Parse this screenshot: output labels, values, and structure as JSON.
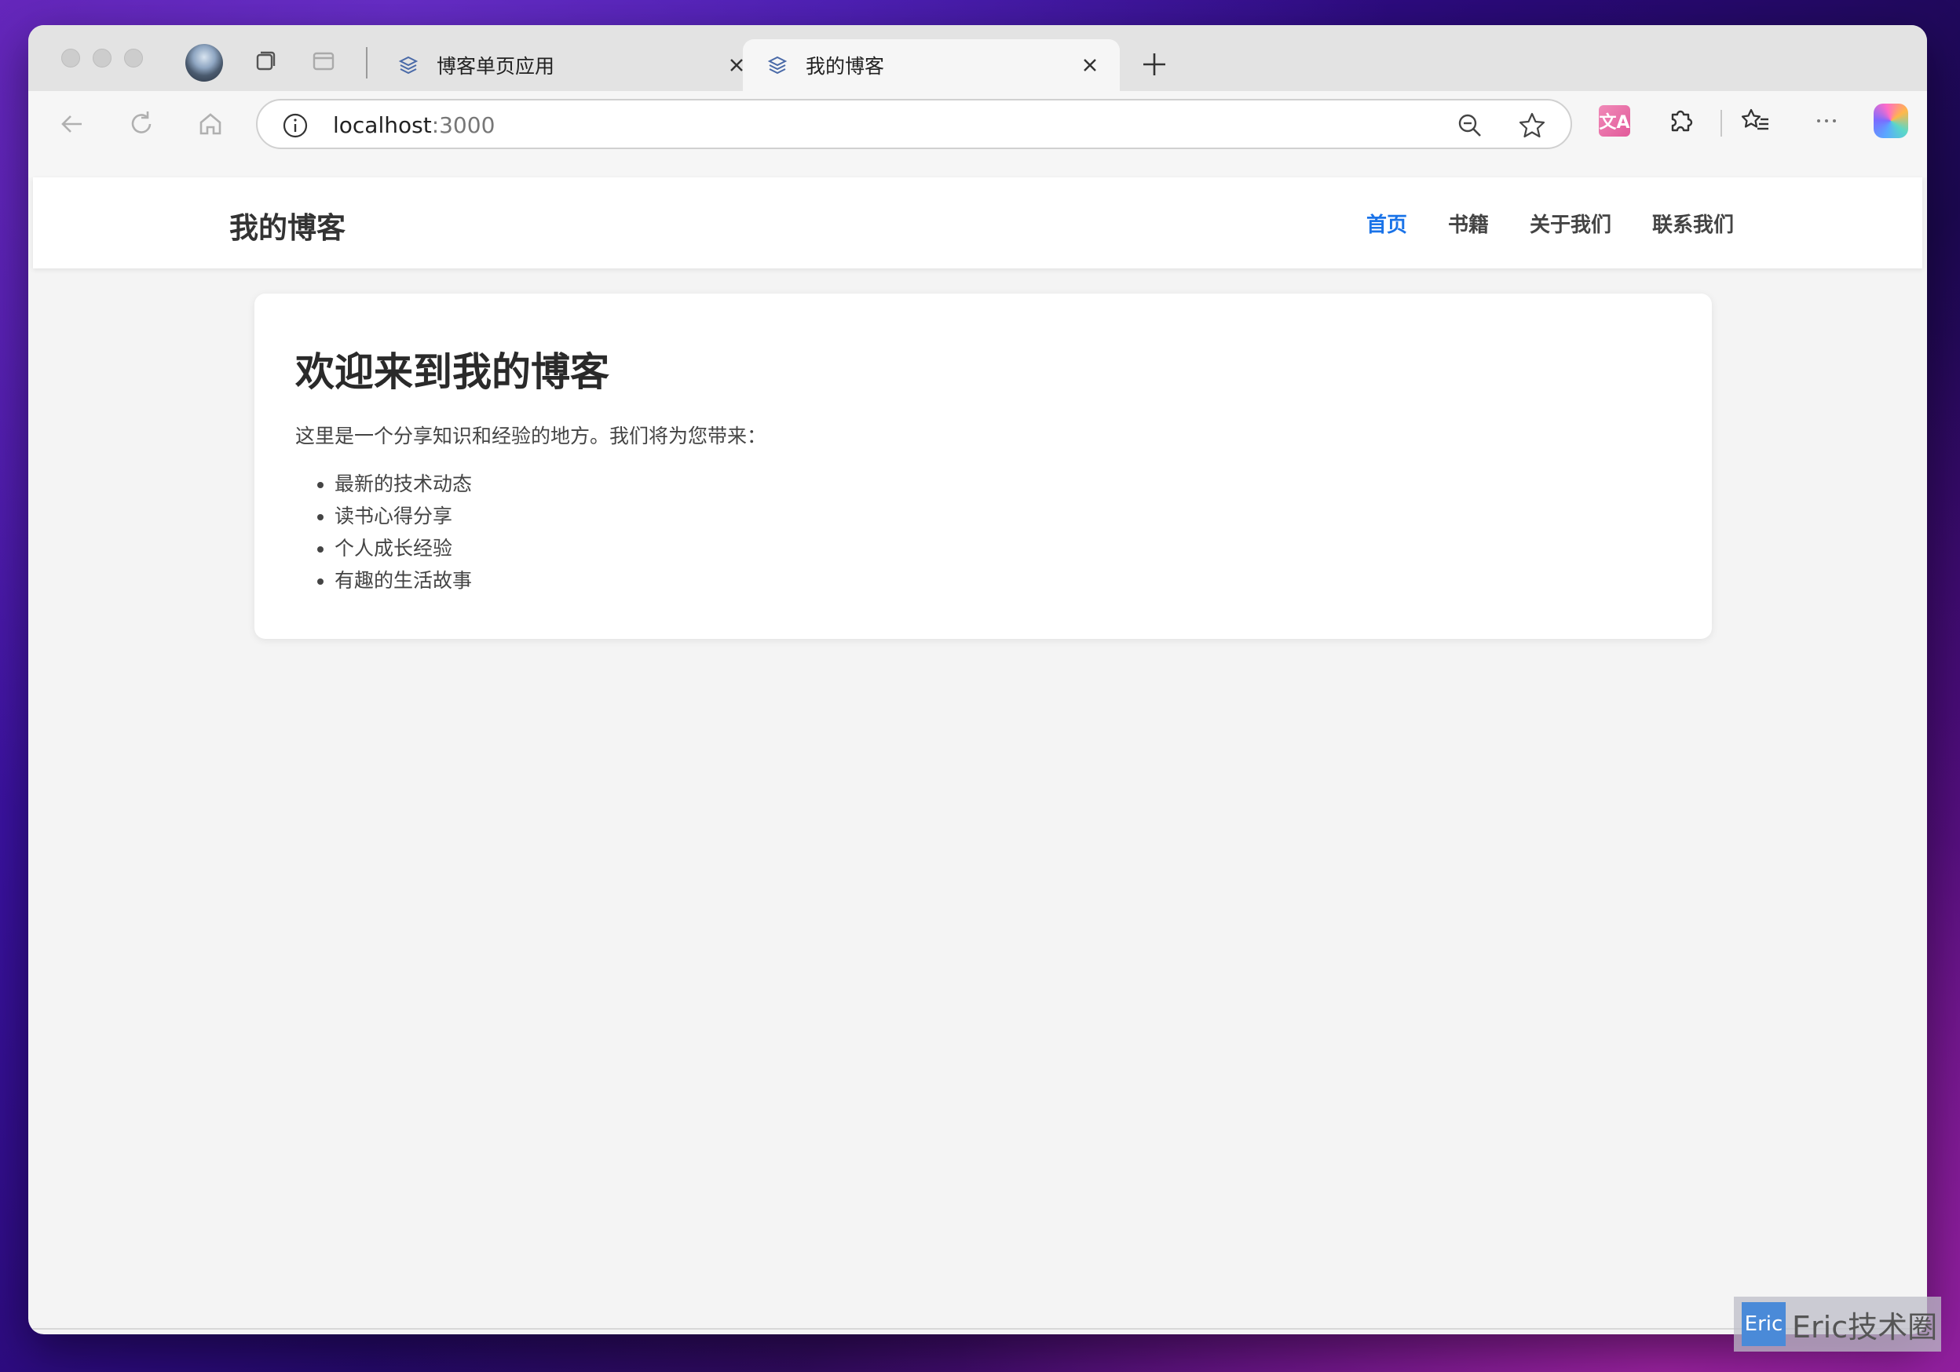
{
  "browser": {
    "tabs": [
      {
        "title": "博客单页应用",
        "active": false
      },
      {
        "title": "我的博客",
        "active": true
      }
    ],
    "address": {
      "host": "localhost",
      "port": ":3000"
    },
    "translate_label": "文A"
  },
  "site": {
    "logo": "我的博客",
    "nav": [
      {
        "label": "首页",
        "active": true
      },
      {
        "label": "书籍",
        "active": false
      },
      {
        "label": "关于我们",
        "active": false
      },
      {
        "label": "联系我们",
        "active": false
      }
    ],
    "card": {
      "title": "欢迎来到我的博客",
      "intro": "这里是一个分享知识和经验的地方。我们将为您带来：",
      "items": [
        "最新的技术动态",
        "读书心得分享",
        "个人成长经验",
        "有趣的生活故事"
      ]
    }
  },
  "watermark": {
    "badge": "Eric",
    "text": "Eric技术圈"
  },
  "colors": {
    "accent": "#1a73e8"
  }
}
